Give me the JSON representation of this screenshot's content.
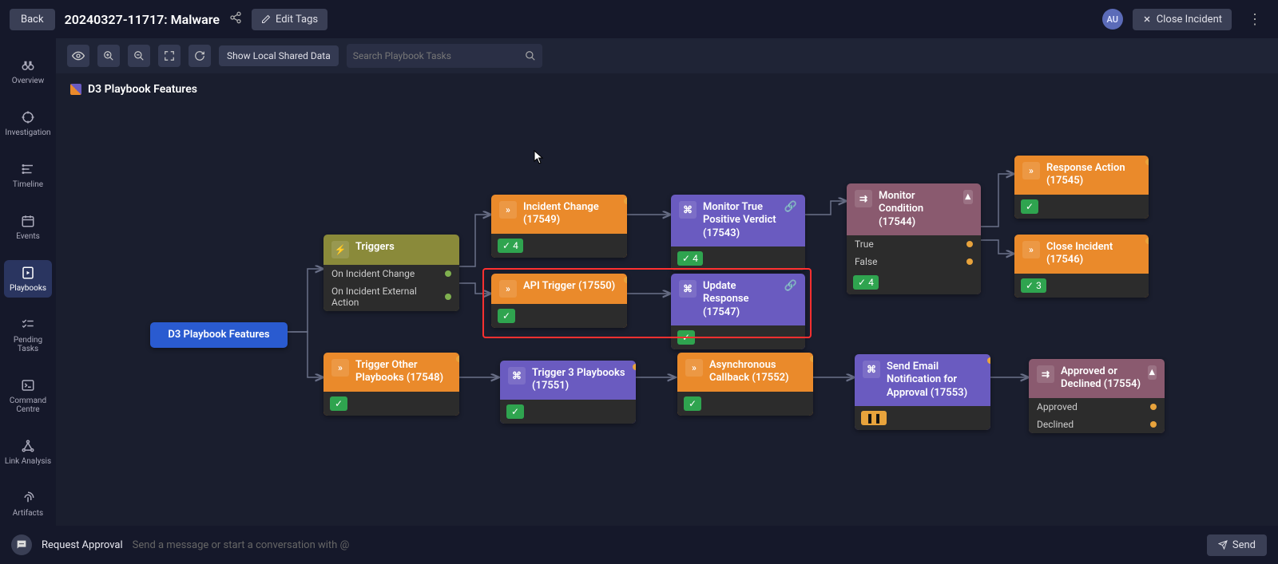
{
  "top": {
    "back": "Back",
    "title": "20240327-11717: Malware",
    "editTags": "Edit Tags",
    "avatar": "AU",
    "close": "Close Incident"
  },
  "nav": {
    "items": [
      {
        "label": "Overview"
      },
      {
        "label": "Investigation"
      },
      {
        "label": "Timeline"
      },
      {
        "label": "Events"
      },
      {
        "label": "Playbooks"
      },
      {
        "label": "Pending Tasks"
      },
      {
        "label": "Command Centre"
      },
      {
        "label": "Link Analysis"
      },
      {
        "label": "Artifacts"
      }
    ],
    "activeIndex": 4
  },
  "toolbar": {
    "showData": "Show Local Shared Data",
    "searchPlaceholder": "Search Playbook Tasks"
  },
  "canvas": {
    "title": "D3 Playbook Features",
    "root": {
      "label": "D3 Playbook Features"
    },
    "triggers": {
      "title": "Triggers",
      "items": [
        "On Incident Change",
        "On Incident External Action"
      ]
    },
    "nodes": {
      "incidentChange": {
        "label": "Incident Change (17549)",
        "count": "4"
      },
      "monitorTP": {
        "label": "Monitor True Positive Verdict (17543)",
        "count": "4"
      },
      "monitorCond": {
        "label": "Monitor Condition (17544)",
        "count": "4",
        "branches": [
          "True",
          "False"
        ]
      },
      "respAction": {
        "label": "Response Action (17545)"
      },
      "closeInc": {
        "label": "Close Incident (17546)",
        "count": "3"
      },
      "apiTrigger": {
        "label": "API Trigger (17550)"
      },
      "updateResp": {
        "label": "Update Response (17547)"
      },
      "triggerOther": {
        "label": "Trigger Other Playbooks (17548)"
      },
      "trigger3": {
        "label": "Trigger 3 Playbooks (17551)"
      },
      "asyncCb": {
        "label": "Asynchronous Callback (17552)"
      },
      "sendEmail": {
        "label": "Send Email Notification for Approval (17553)"
      },
      "approvedOr": {
        "label": "Approved or Declined (17554)",
        "branches": [
          "Approved",
          "Declined"
        ]
      }
    }
  },
  "bottom": {
    "requestApproval": "Request Approval",
    "msgPlaceholder": "Send a message or start a conversation with @",
    "send": "Send"
  }
}
